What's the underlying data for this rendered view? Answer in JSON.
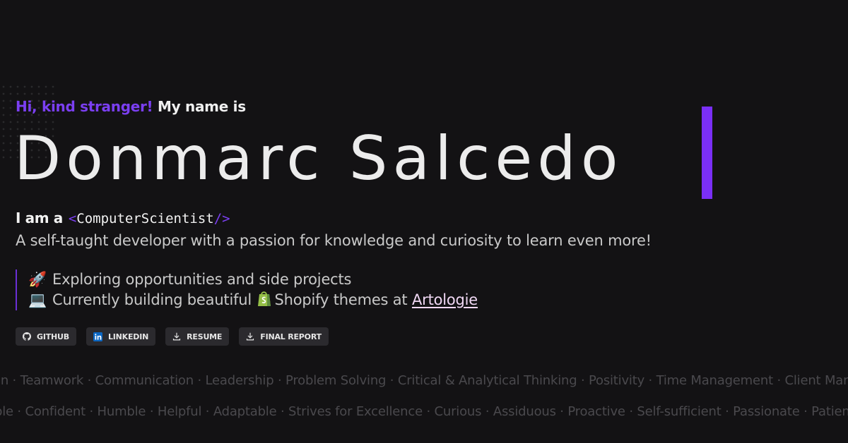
{
  "hero": {
    "greeting_accent": "Hi, kind stranger!",
    "greeting_plain": "My name is",
    "name": "Donmarc Salcedo",
    "role_lead": "I am a",
    "role_open": "<",
    "role_title": "ComputerScientist",
    "role_close": "/>",
    "tagline": "A self-taught developer with a passion for knowledge and curiosity to learn even more!"
  },
  "status": [
    {
      "icon": "rocket-icon",
      "emoji": "🚀",
      "text": "Exploring opportunities and side projects"
    },
    {
      "icon": "laptop-icon",
      "emoji": "💻",
      "text_before": "Currently building beautiful",
      "text_after": "Shopify themes at",
      "link": "Artologie"
    }
  ],
  "buttons": [
    {
      "id": "github",
      "icon": "github-icon",
      "label": "GITHUB"
    },
    {
      "id": "linkedin",
      "icon": "linkedin-icon",
      "label": "LINKEDIN"
    },
    {
      "id": "resume",
      "icon": "download-icon",
      "label": "RESUME"
    },
    {
      "id": "final-report",
      "icon": "download-icon",
      "label": "FINAL REPORT"
    }
  ],
  "marquee": {
    "row1": "on · Teamwork · Communication · Leadership · Problem Solving · Critical & Analytical Thinking · Positivity · Time Management · Client Managem",
    "row2": "ble · Confident · Humble · Helpful · Adaptable · Strives for Excellence · Curious · Assiduous · Proactive · Self-sufficient · Passionate · Patient · E"
  },
  "colors": {
    "background": "#131214",
    "accent": "#7a2ff7",
    "link": "#f0d8f4",
    "button_bg": "#2b2a2e"
  }
}
